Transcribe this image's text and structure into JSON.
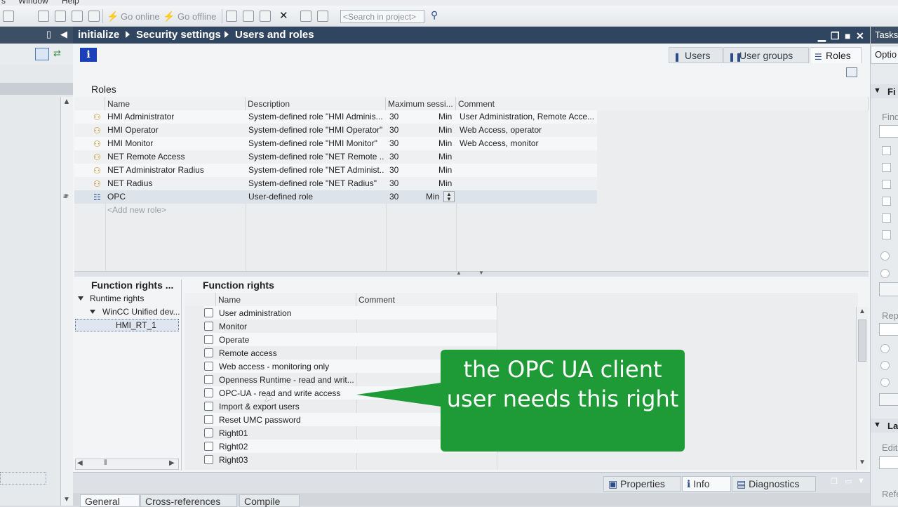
{
  "menu": {
    "items": [
      "s",
      "Window",
      "Help"
    ]
  },
  "toolbar": {
    "go_online": "Go online",
    "go_offline": "Go offline",
    "search_placeholder": "<Search in project>"
  },
  "breadcrumb": [
    "initialize",
    "Security settings",
    "Users and roles"
  ],
  "editor_tabs": [
    "Users",
    "User groups",
    "Roles"
  ],
  "roles": {
    "title": "Roles",
    "columns": [
      "Name",
      "Description",
      "Maximum sessi...",
      "Comment"
    ],
    "rows": [
      {
        "name": "HMI Administrator",
        "description": "System-defined role \"HMI Adminis...",
        "max": "30",
        "unit": "Min",
        "comment": "User Administration, Remote Acce..."
      },
      {
        "name": "HMI Operator",
        "description": "System-defined role \"HMI Operator\"",
        "max": "30",
        "unit": "Min",
        "comment": "Web Access, operator"
      },
      {
        "name": "HMI Monitor",
        "description": "System-defined role \"HMI Monitor\"",
        "max": "30",
        "unit": "Min",
        "comment": "Web Access, monitor"
      },
      {
        "name": "NET Remote Access",
        "description": "System-defined role \"NET Remote ...",
        "max": "30",
        "unit": "Min",
        "comment": ""
      },
      {
        "name": "NET Administrator Radius",
        "description": "System-defined role \"NET Administ...",
        "max": "30",
        "unit": "Min",
        "comment": ""
      },
      {
        "name": "NET Radius",
        "description": "System-defined role \"NET Radius\"",
        "max": "30",
        "unit": "Min",
        "comment": ""
      },
      {
        "name": "OPC",
        "description": "User-defined role",
        "max": "30",
        "unit": "Min",
        "comment": ""
      }
    ],
    "add_new": "<Add new role>"
  },
  "function_rights_tree": {
    "title": "Function rights ...",
    "root": "Runtime rights",
    "child": "WinCC Unified dev...",
    "leaf": "HMI_RT_1"
  },
  "function_rights": {
    "title": "Function rights",
    "columns": [
      "Name",
      "Comment"
    ],
    "items": [
      "User administration",
      "Monitor",
      "Operate",
      "Remote access",
      "Web access - monitoring only",
      "Openness Runtime - read and writ...",
      "OPC-UA - read and write access",
      "Import & export users",
      "Reset UMC password",
      "Right01",
      "Right02",
      "Right03"
    ]
  },
  "callout": {
    "text": "the OPC UA client user needs this right"
  },
  "inspector_tabs": [
    "Properties",
    "Info",
    "Diagnostics"
  ],
  "bottom_tabs": [
    "General",
    "Cross-references",
    "Compile"
  ],
  "task_pane": {
    "title": "Tasks",
    "options": "Optio",
    "find": "Fi",
    "find_label": "Find",
    "replace": "Repl",
    "languages": "La",
    "editing": "Editi",
    "reference": "Refe"
  },
  "colors": {
    "header_bg": "#304660",
    "callout_bg": "#1e9a36",
    "info_blue": "#1a3fb8"
  }
}
